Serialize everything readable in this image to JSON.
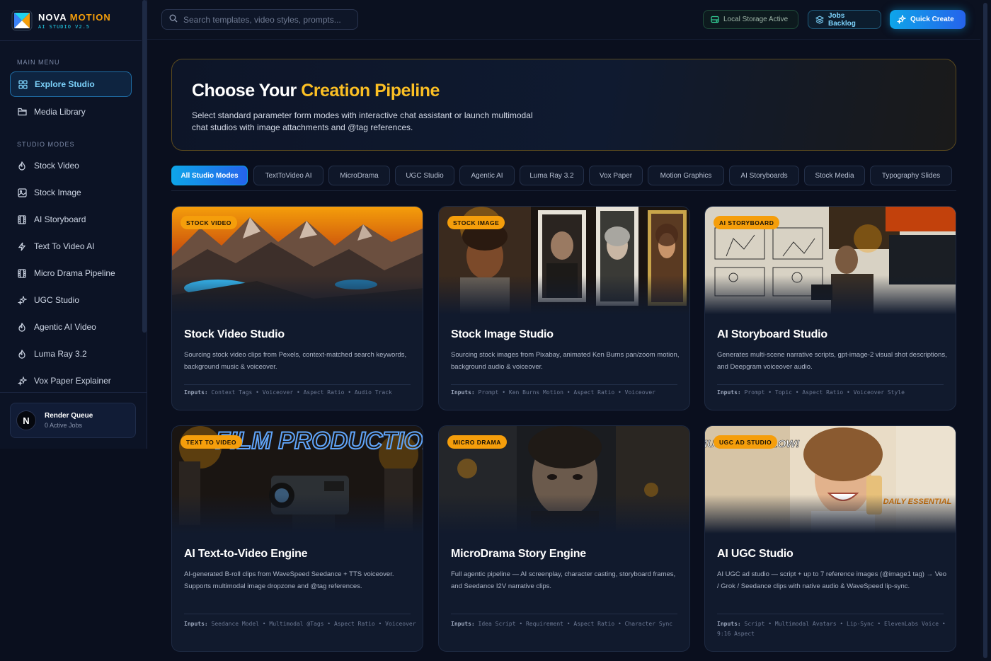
{
  "brand": {
    "name_a": "NOVA ",
    "name_b": "MOTION",
    "sub": "AI STUDIO V2.5"
  },
  "sidebar": {
    "main_heading": "MAIN MENU",
    "main_items": [
      {
        "label": "Explore Studio",
        "icon": "grid-icon",
        "active": true
      },
      {
        "label": "Media Library",
        "icon": "folder-icon"
      }
    ],
    "modes_heading": "STUDIO MODES",
    "mode_items": [
      {
        "label": "Stock Video",
        "icon": "flame-icon"
      },
      {
        "label": "Stock Image",
        "icon": "image-icon"
      },
      {
        "label": "AI Storyboard",
        "icon": "film-icon"
      },
      {
        "label": "Text To Video AI",
        "icon": "bolt-icon"
      },
      {
        "label": "Micro Drama Pipeline",
        "icon": "film-icon"
      },
      {
        "label": "UGC Studio",
        "icon": "sparkle-icon"
      },
      {
        "label": "Agentic AI Video",
        "icon": "flame-icon"
      },
      {
        "label": "Luma Ray 3.2",
        "icon": "flame-icon"
      },
      {
        "label": "Vox Paper Explainer",
        "icon": "sparkle-icon"
      }
    ],
    "render_queue": {
      "avatar": "N",
      "title": "Render Queue",
      "sub": "0 Active Jobs"
    }
  },
  "topbar": {
    "search_placeholder": "Search templates, video styles, prompts...",
    "storage_label": "Local Storage Active",
    "jobs_label": "Jobs Backlog",
    "create_label": "Quick Create"
  },
  "hero": {
    "title_a": "Choose Your ",
    "title_b": "Creation Pipeline",
    "desc": "Select standard parameter form modes with interactive chat assistant or launch multimodal chat studios with image attachments and @tag references."
  },
  "filters": [
    "All Studio Modes",
    "TextToVideo AI",
    "MicroDrama",
    "UGC Studio",
    "Agentic AI",
    "Luma Ray 3.2",
    "Vox Paper",
    "Motion Graphics",
    "AI Storyboards",
    "Stock Media",
    "Typography Slides"
  ],
  "cards": [
    {
      "badge": "STOCK VIDEO",
      "title": "Stock Video Studio",
      "desc": "Sourcing stock video clips from Pexels, context-matched search keywords, background music & voiceover.",
      "inputs_label": "Inputs:",
      "inputs": "Context Tags • Voiceover • Aspect Ratio • Audio Track"
    },
    {
      "badge": "STOCK IMAGE",
      "title": "Stock Image Studio",
      "desc": "Sourcing stock images from Pixabay, animated Ken Burns pan/zoom motion, background audio & voiceover.",
      "inputs_label": "Inputs:",
      "inputs": "Prompt • Ken Burns Motion • Aspect Ratio • Voiceover"
    },
    {
      "badge": "AI STORYBOARD",
      "title": "AI Storyboard Studio",
      "desc": "Generates multi-scene narrative scripts, gpt-image-2 visual shot descriptions, and Deepgram voiceover audio.",
      "inputs_label": "Inputs:",
      "inputs": "Prompt • Topic • Aspect Ratio • Voiceover Style"
    },
    {
      "badge": "TEXT TO VIDEO",
      "title": "AI Text-to-Video Engine",
      "desc": "AI-generated B-roll clips from WaveSpeed Seedance + TTS voiceover. Supports multimodal image dropzone and @tag references.",
      "inputs_label": "Inputs:",
      "inputs": "Seedance Model • Multimodal @Tags • Aspect Ratio • Voiceover",
      "img_text": "FILM PRODUCTION"
    },
    {
      "badge": "MICRO DRAMA",
      "title": "MicroDrama Story Engine",
      "desc": "Full agentic pipeline — AI screenplay, character casting, storyboard frames, and Seedance I2V narrative clips.",
      "inputs_label": "Inputs:",
      "inputs": "Idea Script • Requirement • Aspect Ratio • Character Sync"
    },
    {
      "badge": "UGC AD STUDIO",
      "title": "AI UGC Studio",
      "desc": "AI UGC ad studio — script + up to 7 reference images (@image1 tag) → Veo / Grok / Seedance clips with native audio & WaveSpeed lip-sync.",
      "inputs_label": "Inputs:",
      "inputs": "Script • Multimodal Avatars • Lip-Sync • ElevenLabs Voice • 9:16 Aspect",
      "img_text_a": "MUST HAVE GLOW!",
      "img_text_b": "DAILY ESSENTIAL"
    }
  ]
}
